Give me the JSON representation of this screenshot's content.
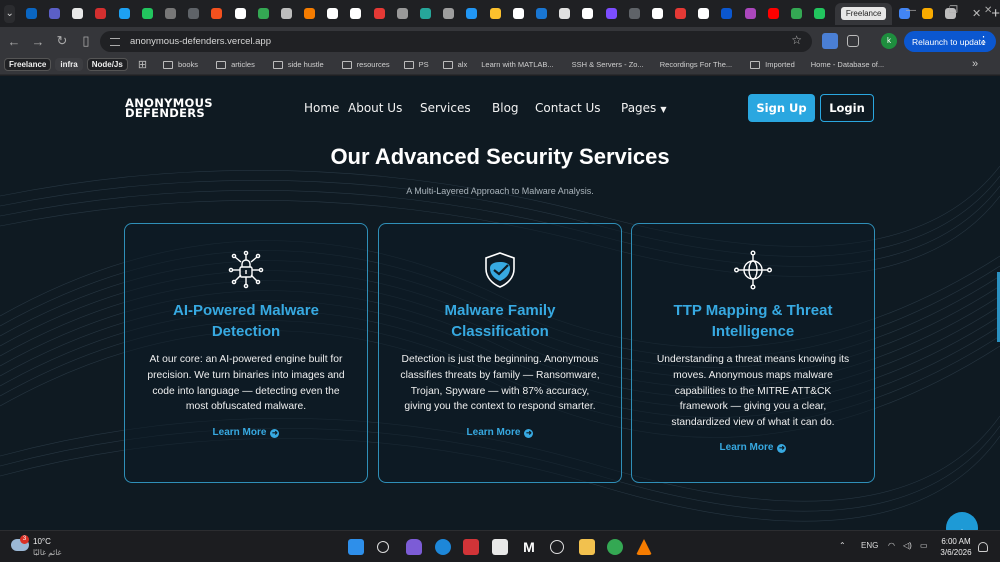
{
  "browser": {
    "tabs": {
      "active_label": "Freelance",
      "favicon_colors": [
        "#0a66c2",
        "#5b5fc7",
        "#e8e8e8",
        "#d32f2f",
        "#1da1f2",
        "#22c55e",
        "#777777",
        "#5f6368",
        "#f4511e",
        "#ffffff",
        "#34a853",
        "#bdbdbd",
        "#f57c00",
        "#ffffff",
        "#ffffff",
        "#e53935",
        "#999999",
        "#26a69a",
        "#9e9e9e",
        "#2196f3",
        "#fbc02d",
        "#ffffff",
        "#1976d2",
        "#e0e0e0",
        "#ffffff",
        "#7c4dff",
        "#5f6368",
        "#ffffff",
        "#e53935",
        "#ffffff",
        "#0b57d0",
        "#ab47bc",
        "#ff0000",
        "#34a853",
        "#22c55e"
      ],
      "trailing_favicon_colors": [
        "#4285f4",
        "#f9ab00",
        "#bdbdbd"
      ]
    },
    "toolbar": {
      "url": "anonymous-defenders.vercel.app",
      "relaunch_label": "Relaunch to update",
      "profile_letter": "k"
    },
    "bookmarks": [
      {
        "label": "Freelance",
        "type": "chip"
      },
      {
        "label": "infra",
        "type": "chip-plain"
      },
      {
        "label": "Node/Js",
        "type": "chip"
      },
      {
        "label": "books",
        "type": "folder"
      },
      {
        "label": "articles",
        "type": "folder"
      },
      {
        "label": "side hustle",
        "type": "folder"
      },
      {
        "label": "resources",
        "type": "folder"
      },
      {
        "label": "PS",
        "type": "folder"
      },
      {
        "label": "alx",
        "type": "folder"
      },
      {
        "label": "Learn with MATLAB...",
        "type": "site",
        "color": "#e8710a"
      },
      {
        "label": "SSH & Servers - Zo...",
        "type": "site",
        "color": "#2d8cff"
      },
      {
        "label": "Recordings For The...",
        "type": "site",
        "color": "#444444"
      },
      {
        "label": "Imported",
        "type": "folder"
      },
      {
        "label": "Home - Database of...",
        "type": "site",
        "color": "#4a90e2"
      }
    ]
  },
  "site": {
    "logo_line1": "ANONYMOUS",
    "logo_line2": "DEFENDERS",
    "nav": [
      "Home",
      "About Us",
      "Services",
      "Blog",
      "Contact Us",
      "Pages"
    ],
    "signup_label": "Sign Up",
    "login_label": "Login",
    "hero_title": "Our Advanced Security Services",
    "hero_subtitle": "A Multi-Layered Approach to Malware Analysis.",
    "accent_color": "#37a9e1",
    "cards": [
      {
        "icon": "ai-lock-icon",
        "title_line1": "AI-Powered Malware",
        "title_line2": "Detection",
        "text": "At our core: an AI-powered engine built for precision. We turn binaries into images and code into language — detecting even the most obfuscated malware.",
        "link": "Learn More"
      },
      {
        "icon": "shield-check-icon",
        "title_line1": "Malware Family",
        "title_line2": "Classification",
        "text": "Detection is just the beginning. Anonymous classifies threats by family — Ransomware, Trojan, Spyware — with 87% accuracy, giving you the context to respond smarter.",
        "link": "Learn More"
      },
      {
        "icon": "network-globe-icon",
        "title_line1": "TTP Mapping & Threat",
        "title_line2": "Intelligence",
        "text": "Understanding a threat means knowing its moves. Anonymous maps malware capabilities to the MITRE ATT&CK framework — giving you a clear, standardized view of what it can do.",
        "link": "Learn More"
      }
    ]
  },
  "taskbar": {
    "weather_temp": "10°C",
    "weather_condition": "غائم غالبًا",
    "weather_badge": "3",
    "language": "ENG",
    "time": "6:00 AM",
    "date": "3/6/2026"
  }
}
